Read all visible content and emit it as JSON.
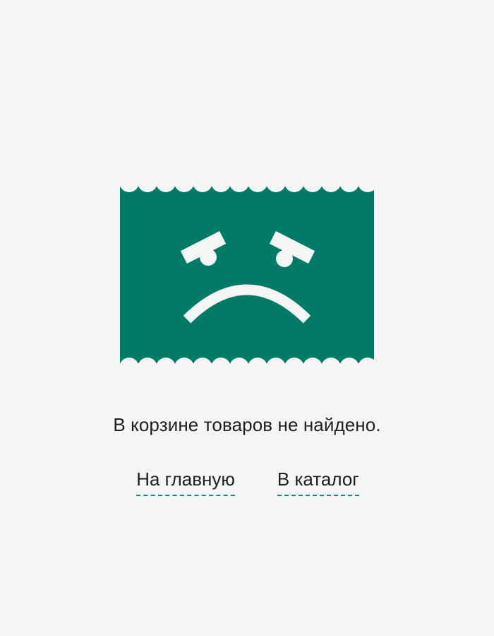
{
  "empty_cart": {
    "message": "В корзине товаров не найдено.",
    "illustration_icon": "sad-face-icon",
    "colors": {
      "brand_green": "#007b68",
      "background": "#f5f5f5",
      "link_underline": "#138a7a"
    }
  },
  "links": {
    "home_label": "На главную",
    "catalog_label": "В каталог"
  }
}
